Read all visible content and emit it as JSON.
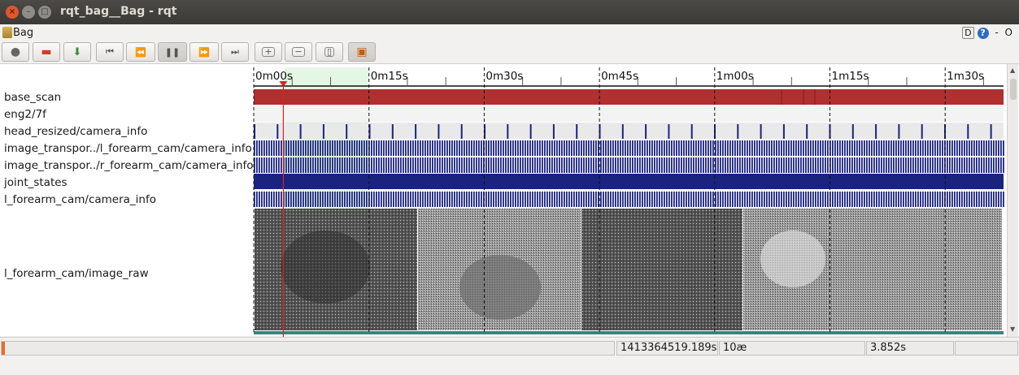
{
  "window": {
    "title": "rqt_bag__Bag - rqt",
    "close_glyph": "×",
    "minimize_glyph": "–",
    "maximize_glyph": "□"
  },
  "plugin": {
    "title": "Bag",
    "icon": "bag-icon",
    "dock_label": "D",
    "help_label": "?",
    "minimize_label": "-",
    "close_label": "O"
  },
  "toolbar": {
    "buttons": [
      {
        "name": "record-button",
        "icon": "record-icon",
        "glyph": "●"
      },
      {
        "name": "load-bag-button",
        "icon": "open-folder-icon",
        "glyph": "▬"
      },
      {
        "name": "save-bag-button",
        "icon": "save-icon",
        "glyph": "⬇"
      },
      {
        "name": "go-to-start-button",
        "icon": "skip-start-icon",
        "glyph": "⏮"
      },
      {
        "name": "rewind-button",
        "icon": "rewind-icon",
        "glyph": "⏪"
      },
      {
        "name": "pause-button",
        "icon": "pause-icon",
        "glyph": "❚❚"
      },
      {
        "name": "fast-forward-button",
        "icon": "fast-forward-icon",
        "glyph": "⏩"
      },
      {
        "name": "go-to-end-button",
        "icon": "skip-end-icon",
        "glyph": "⏭"
      },
      {
        "name": "zoom-in-button",
        "icon": "zoom-in-icon",
        "glyph": "+"
      },
      {
        "name": "zoom-out-button",
        "icon": "zoom-out-icon",
        "glyph": "−"
      },
      {
        "name": "zoom-reset-button",
        "icon": "zoom-reset-icon",
        "glyph": "▯"
      },
      {
        "name": "thumbnails-button",
        "icon": "image-thumbnail-icon",
        "glyph": "▣"
      }
    ]
  },
  "timeline": {
    "tick_labels": [
      "0m00s",
      "0m15s",
      "0m30s",
      "0m45s",
      "1m00s",
      "1m15s",
      "1m30s"
    ],
    "topics": [
      "base_scan",
      "eng2/7f",
      "head_resized/camera_info",
      "image_transpor../l_forearm_cam/camera_info",
      "image_transpor../r_forearm_cam/camera_info",
      "joint_states",
      "l_forearm_cam/camera_info",
      "l_forearm_cam/image_raw"
    ],
    "playhead_seconds": 3.852,
    "selection_seconds": [
      4,
      15
    ],
    "colors": {
      "base_scan": "#b03030",
      "message_ticks": "#1a237e",
      "selection": "#d8f2d8",
      "playhead": "#e02020"
    }
  },
  "status": {
    "progress_fraction": 0.004,
    "timestamp": "1413364519.189s",
    "rate": "10æ",
    "elapsed": "3.852s"
  }
}
